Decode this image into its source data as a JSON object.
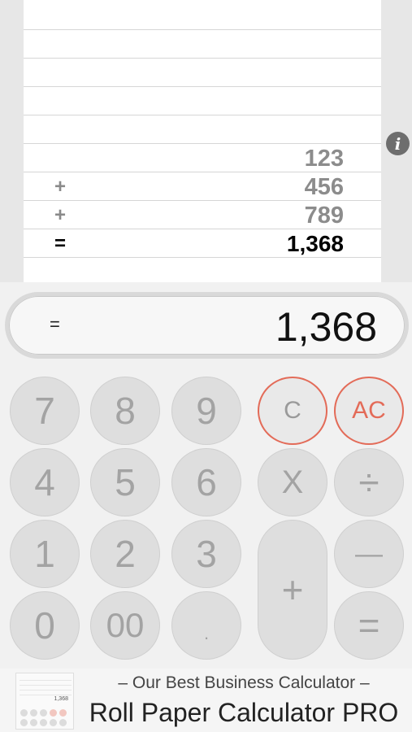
{
  "tape": {
    "rows": [
      {
        "op": "",
        "value": "123"
      },
      {
        "op": "+",
        "value": "456"
      },
      {
        "op": "+",
        "value": "789"
      },
      {
        "op": "=",
        "value": "1,368"
      }
    ]
  },
  "info_button": {
    "label": "i"
  },
  "display": {
    "operator": "=",
    "value": "1,368"
  },
  "keys": {
    "k7": "7",
    "k8": "8",
    "k9": "9",
    "clear": "C",
    "all_clear": "AC",
    "k4": "4",
    "k5": "5",
    "k6": "6",
    "multiply": "X",
    "divide": "÷",
    "k1": "1",
    "k2": "2",
    "k3": "3",
    "plus": "+",
    "minus": "—",
    "k0": "0",
    "k00": "00",
    "decimal": ".",
    "equals": "="
  },
  "ad": {
    "tagline": "– Our Best Business Calculator –",
    "title": "Roll Paper Calculator PRO",
    "thumb_value": "1,368"
  },
  "colors": {
    "accent_red": "#e36b58",
    "key_gray": "#dedede",
    "key_text": "#a3a3a3"
  }
}
